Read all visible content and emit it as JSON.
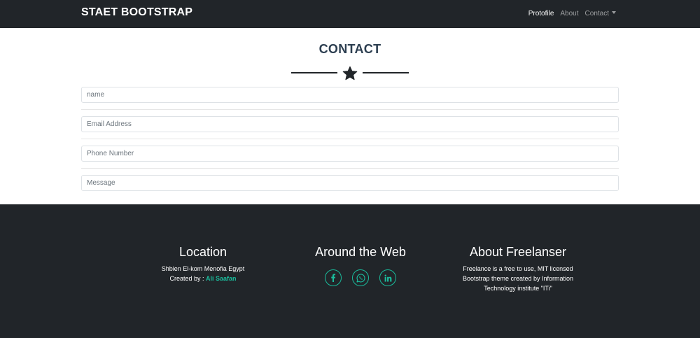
{
  "navbar": {
    "brand": "STAET BOOTSTRAP",
    "links": [
      {
        "label": "Protofile",
        "active": true
      },
      {
        "label": "About",
        "active": false
      },
      {
        "label": "Contact",
        "active": false,
        "dropdown": true
      }
    ]
  },
  "contact": {
    "title": "CONTACT",
    "fields": {
      "name": {
        "placeholder": "name",
        "value": ""
      },
      "email": {
        "placeholder": "Email Address",
        "value": ""
      },
      "phone": {
        "placeholder": "Phone Number",
        "value": ""
      },
      "message": {
        "placeholder": "Message",
        "value": ""
      }
    }
  },
  "footer": {
    "location": {
      "title": "Location",
      "address": "Shbien El-kom Menofia Egypt",
      "created_by_label": "Created by :",
      "author": "Ali Saafan"
    },
    "web": {
      "title": "Around the Web",
      "icons": [
        "facebook-icon",
        "whatsapp-icon",
        "linkedin-icon"
      ]
    },
    "about": {
      "title": "About Freelanser",
      "lines": [
        "Freelance is a free to use, MIT licensed",
        "Bootstrap theme created by Information",
        "Technology institute \"ITi\""
      ]
    }
  },
  "colors": {
    "dark": "#212529",
    "accent": "#1abc9c",
    "heading": "#2c3e50"
  }
}
